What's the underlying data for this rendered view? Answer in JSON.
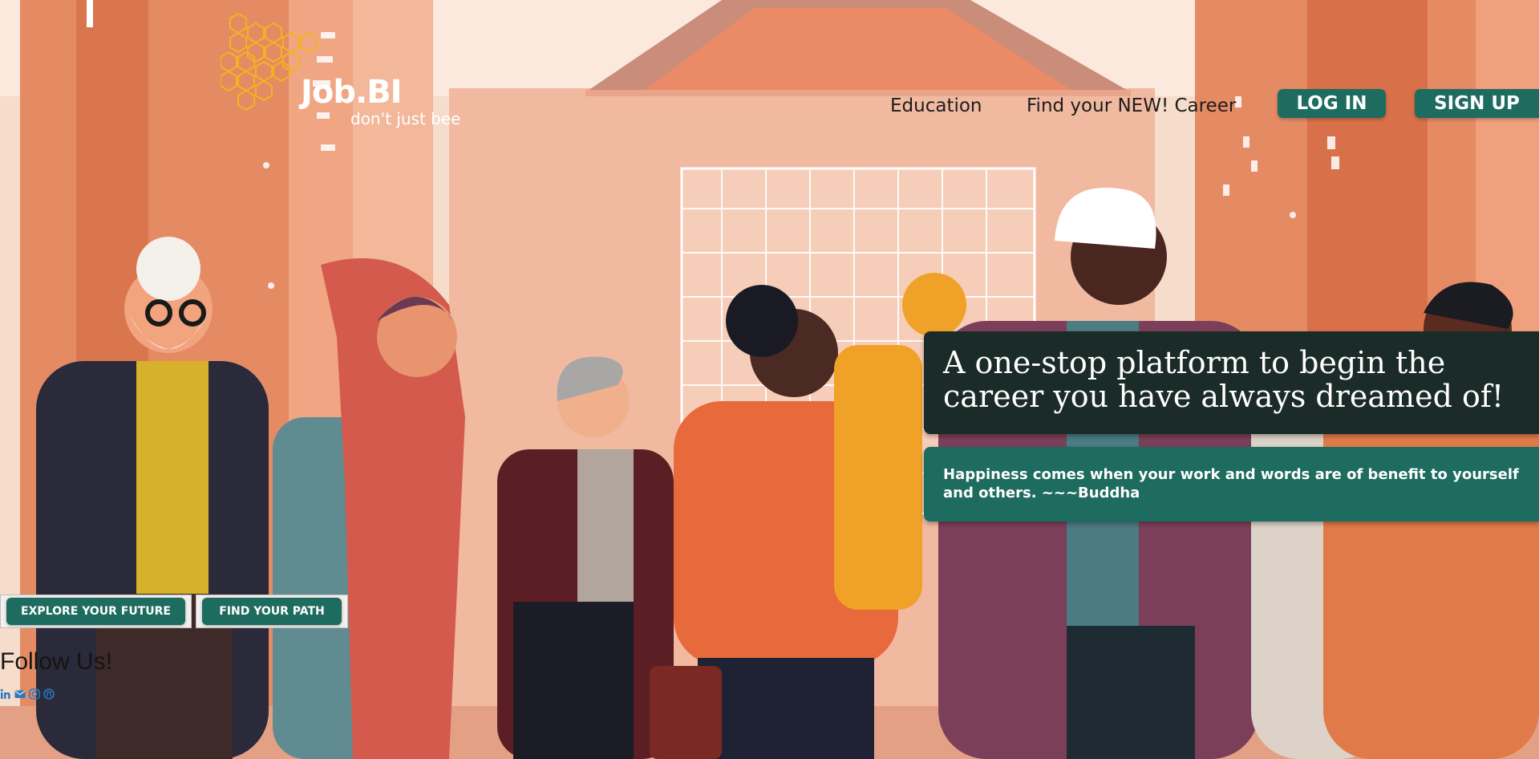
{
  "logo": {
    "brand": "Job.BI",
    "tagline": "don't just bee"
  },
  "nav": {
    "links": [
      "Education",
      "Find your NEW! Career"
    ],
    "login_label": "LOG IN",
    "signup_label": "SIGN UP"
  },
  "hero": {
    "headline": "A one-stop platform to begin the career you have always dreamed of!",
    "quote": "Happiness comes when your work and words are of benefit to yourself and others. ~~~Buddha"
  },
  "cta": {
    "explore_label": "EXPLORE YOUR FUTURE",
    "path_label": "FIND YOUR PATH"
  },
  "follow": {
    "title": "Follow Us!",
    "icons": [
      "linkedin-icon",
      "email-icon",
      "instagram-icon",
      "github-icon"
    ]
  },
  "colors": {
    "accent": "#1e6b5f",
    "hero_card": "#1b2b28",
    "logo_hex": "#f4b21f",
    "social_icon": "#2b78c4",
    "background": "#f7d9c4"
  }
}
